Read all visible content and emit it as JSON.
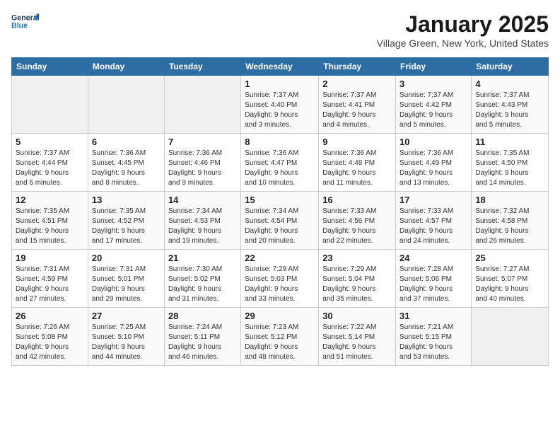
{
  "header": {
    "logo_line1": "General",
    "logo_line2": "Blue",
    "month": "January 2025",
    "location": "Village Green, New York, United States"
  },
  "weekdays": [
    "Sunday",
    "Monday",
    "Tuesday",
    "Wednesday",
    "Thursday",
    "Friday",
    "Saturday"
  ],
  "weeks": [
    [
      {
        "day": "",
        "info": ""
      },
      {
        "day": "",
        "info": ""
      },
      {
        "day": "",
        "info": ""
      },
      {
        "day": "1",
        "info": "Sunrise: 7:37 AM\nSunset: 4:40 PM\nDaylight: 9 hours\nand 3 minutes."
      },
      {
        "day": "2",
        "info": "Sunrise: 7:37 AM\nSunset: 4:41 PM\nDaylight: 9 hours\nand 4 minutes."
      },
      {
        "day": "3",
        "info": "Sunrise: 7:37 AM\nSunset: 4:42 PM\nDaylight: 9 hours\nand 5 minutes."
      },
      {
        "day": "4",
        "info": "Sunrise: 7:37 AM\nSunset: 4:43 PM\nDaylight: 9 hours\nand 5 minutes."
      }
    ],
    [
      {
        "day": "5",
        "info": "Sunrise: 7:37 AM\nSunset: 4:44 PM\nDaylight: 9 hours\nand 6 minutes."
      },
      {
        "day": "6",
        "info": "Sunrise: 7:36 AM\nSunset: 4:45 PM\nDaylight: 9 hours\nand 8 minutes."
      },
      {
        "day": "7",
        "info": "Sunrise: 7:36 AM\nSunset: 4:46 PM\nDaylight: 9 hours\nand 9 minutes."
      },
      {
        "day": "8",
        "info": "Sunrise: 7:36 AM\nSunset: 4:47 PM\nDaylight: 9 hours\nand 10 minutes."
      },
      {
        "day": "9",
        "info": "Sunrise: 7:36 AM\nSunset: 4:48 PM\nDaylight: 9 hours\nand 11 minutes."
      },
      {
        "day": "10",
        "info": "Sunrise: 7:36 AM\nSunset: 4:49 PM\nDaylight: 9 hours\nand 13 minutes."
      },
      {
        "day": "11",
        "info": "Sunrise: 7:35 AM\nSunset: 4:50 PM\nDaylight: 9 hours\nand 14 minutes."
      }
    ],
    [
      {
        "day": "12",
        "info": "Sunrise: 7:35 AM\nSunset: 4:51 PM\nDaylight: 9 hours\nand 15 minutes."
      },
      {
        "day": "13",
        "info": "Sunrise: 7:35 AM\nSunset: 4:52 PM\nDaylight: 9 hours\nand 17 minutes."
      },
      {
        "day": "14",
        "info": "Sunrise: 7:34 AM\nSunset: 4:53 PM\nDaylight: 9 hours\nand 19 minutes."
      },
      {
        "day": "15",
        "info": "Sunrise: 7:34 AM\nSunset: 4:54 PM\nDaylight: 9 hours\nand 20 minutes."
      },
      {
        "day": "16",
        "info": "Sunrise: 7:33 AM\nSunset: 4:56 PM\nDaylight: 9 hours\nand 22 minutes."
      },
      {
        "day": "17",
        "info": "Sunrise: 7:33 AM\nSunset: 4:57 PM\nDaylight: 9 hours\nand 24 minutes."
      },
      {
        "day": "18",
        "info": "Sunrise: 7:32 AM\nSunset: 4:58 PM\nDaylight: 9 hours\nand 26 minutes."
      }
    ],
    [
      {
        "day": "19",
        "info": "Sunrise: 7:31 AM\nSunset: 4:59 PM\nDaylight: 9 hours\nand 27 minutes."
      },
      {
        "day": "20",
        "info": "Sunrise: 7:31 AM\nSunset: 5:01 PM\nDaylight: 9 hours\nand 29 minutes."
      },
      {
        "day": "21",
        "info": "Sunrise: 7:30 AM\nSunset: 5:02 PM\nDaylight: 9 hours\nand 31 minutes."
      },
      {
        "day": "22",
        "info": "Sunrise: 7:29 AM\nSunset: 5:03 PM\nDaylight: 9 hours\nand 33 minutes."
      },
      {
        "day": "23",
        "info": "Sunrise: 7:29 AM\nSunset: 5:04 PM\nDaylight: 9 hours\nand 35 minutes."
      },
      {
        "day": "24",
        "info": "Sunrise: 7:28 AM\nSunset: 5:06 PM\nDaylight: 9 hours\nand 37 minutes."
      },
      {
        "day": "25",
        "info": "Sunrise: 7:27 AM\nSunset: 5:07 PM\nDaylight: 9 hours\nand 40 minutes."
      }
    ],
    [
      {
        "day": "26",
        "info": "Sunrise: 7:26 AM\nSunset: 5:08 PM\nDaylight: 9 hours\nand 42 minutes."
      },
      {
        "day": "27",
        "info": "Sunrise: 7:25 AM\nSunset: 5:10 PM\nDaylight: 9 hours\nand 44 minutes."
      },
      {
        "day": "28",
        "info": "Sunrise: 7:24 AM\nSunset: 5:11 PM\nDaylight: 9 hours\nand 46 minutes."
      },
      {
        "day": "29",
        "info": "Sunrise: 7:23 AM\nSunset: 5:12 PM\nDaylight: 9 hours\nand 48 minutes."
      },
      {
        "day": "30",
        "info": "Sunrise: 7:22 AM\nSunset: 5:14 PM\nDaylight: 9 hours\nand 51 minutes."
      },
      {
        "day": "31",
        "info": "Sunrise: 7:21 AM\nSunset: 5:15 PM\nDaylight: 9 hours\nand 53 minutes."
      },
      {
        "day": "",
        "info": ""
      }
    ]
  ]
}
